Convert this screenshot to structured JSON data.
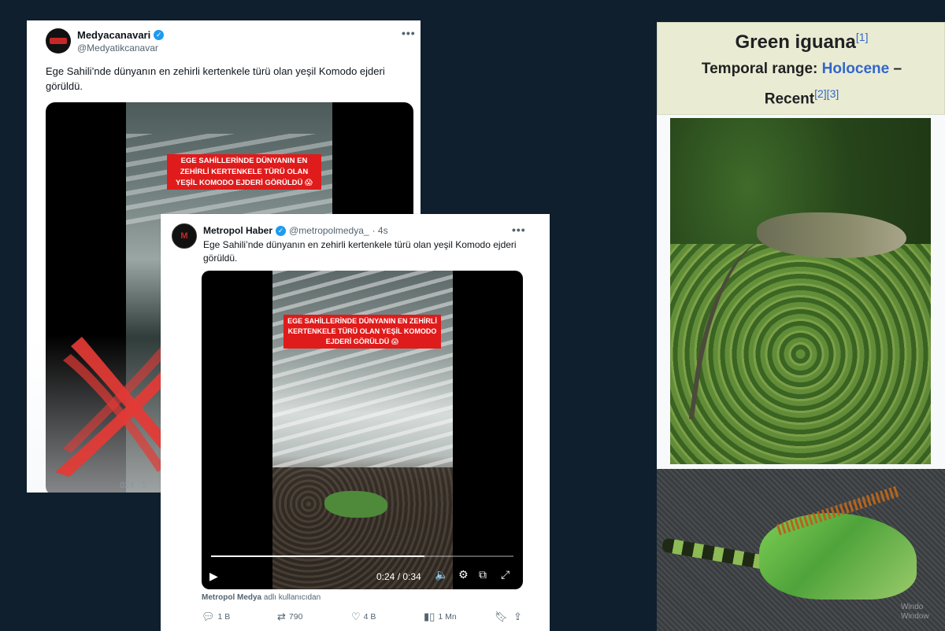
{
  "tweet1": {
    "display_name": "Medyacanavari",
    "handle": "@Medyatikcanavar",
    "more_label": "•••",
    "text": "Ege Sahili’nde dünyanın en zehirli kertenkele türü olan yeşil Komodo ejderi görüldü.",
    "video_overlay": "EGE SAHİLLERİNDE DÜNYANIN EN ZEHİRLİ KERTENKELE TÜRÜ OLAN YEŞİL KOMODO EJDERİ GÖRÜLDÜ 😱",
    "timestamp_fragment": "024 · 5"
  },
  "tweet2": {
    "display_name": "Metropol Haber",
    "handle": "@metropolmedya_",
    "age": "· 4s",
    "more_label": "•••",
    "text": "Ege Sahili’nde dünyanın en zehirli kertenkele türü olan yeşil Komodo ejderi görüldü.",
    "video_overlay": "EGE SAHİLLERİNDE DÜNYANIN EN ZEHİRLİ KERTENKELE TÜRÜ OLAN YEŞİL KOMODO EJDERİ GÖRÜLDÜ 😱",
    "video_time": "0:24 / 0:34",
    "video_progress": 0.706,
    "attribution_account": "Metropol Medya",
    "attribution_suffix": "adlı kullanıcıdan",
    "actions": {
      "replies": "1 B",
      "reposts": "790",
      "likes": "4 B",
      "views": "1 Mn"
    }
  },
  "wiki": {
    "title": "Green iguana",
    "title_ref": "[1]",
    "range_label": "Temporal range:",
    "range_link": "Holocene",
    "range_dash": "–",
    "range_end": "Recent",
    "range_refs": "[2][3]"
  },
  "watermark": {
    "line1": "Windo",
    "line2": "Window"
  },
  "icons": {
    "verified": "verified-badge-icon",
    "play": "play-icon",
    "volume": "volume-icon",
    "settings": "gear-icon",
    "popout": "popout-icon",
    "fullscreen": "fullscreen-icon",
    "reply": "reply-icon",
    "repost": "repost-icon",
    "like": "heart-icon",
    "views": "views-icon",
    "bookmark": "bookmark-icon",
    "share": "share-icon"
  },
  "colors": {
    "background": "#0f1f2e",
    "verified": "#1d9bf0",
    "overlay_red": "#e01b1b",
    "cross_red": "#e53935",
    "wiki_header": "#e9ecd3",
    "wiki_link": "#3366cc"
  }
}
